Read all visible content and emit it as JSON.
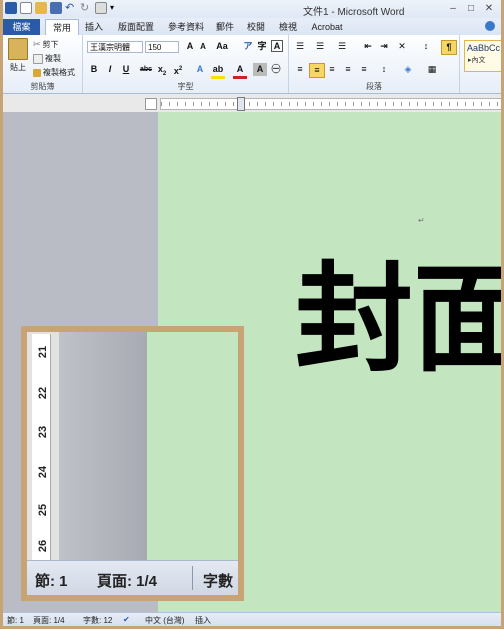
{
  "window": {
    "title": "文件1 - Microsoft Word"
  },
  "tabs": [
    "檔案",
    "常用",
    "插入",
    "版面配置",
    "參考資料",
    "郵件",
    "校閱",
    "檢視",
    "Acrobat"
  ],
  "clipboard": {
    "paste": "貼上",
    "cut": "剪下",
    "copy": "複製",
    "format_painter": "複製格式",
    "label": "剪貼簿"
  },
  "font": {
    "name": "王漢宗明體",
    "size": "150",
    "label": "字型"
  },
  "paragraph": {
    "label": "段落"
  },
  "styles": {
    "preview": "AaBbCc",
    "normal": "▸內文"
  },
  "document": {
    "heading": "封面",
    "para_mark": "↵"
  },
  "statusbar": {
    "section": "節: 1",
    "page": "頁面: 1/4",
    "words": "字數: 12",
    "language": "中文 (台灣)",
    "mode": "插入"
  },
  "magnifier": {
    "ruler_numbers": [
      "21",
      "22",
      "23",
      "24",
      "25",
      "26"
    ],
    "section": "節: 1",
    "page": "頁面: 1/4",
    "words": "字數"
  },
  "colors": {
    "file_tab": "#2a5aa8",
    "page_bg": "#c3e6c0",
    "frame": "#c8a374"
  }
}
